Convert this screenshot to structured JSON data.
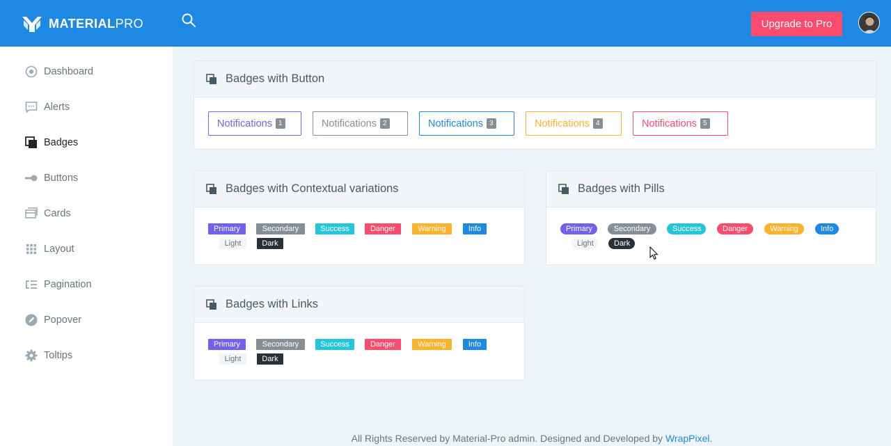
{
  "header": {
    "brand_bold": "MATERIAL",
    "brand_light": "PRO",
    "upgrade_label": "Upgrade to Pro",
    "brand_color": "#1e88e5",
    "upgrade_color": "#fc4b6c"
  },
  "sidebar": {
    "items": [
      {
        "label": "Dashboard",
        "icon": "target-icon"
      },
      {
        "label": "Alerts",
        "icon": "message-icon"
      },
      {
        "label": "Badges",
        "icon": "copy-icon",
        "active": true
      },
      {
        "label": "Buttons",
        "icon": "toggle-icon"
      },
      {
        "label": "Cards",
        "icon": "cards-icon"
      },
      {
        "label": "Layout",
        "icon": "grid-icon"
      },
      {
        "label": "Pagination",
        "icon": "list-icon"
      },
      {
        "label": "Popover",
        "icon": "pen-icon"
      },
      {
        "label": "Toltips",
        "icon": "gear-icon"
      }
    ]
  },
  "cards": {
    "buttons": {
      "title": "Badges with Button",
      "items": [
        {
          "label": "Notifications",
          "count": "1",
          "color": "#7460ee"
        },
        {
          "label": "Notifications",
          "count": "2",
          "color": "#868e96"
        },
        {
          "label": "Notifications",
          "count": "3",
          "color": "#1e88e5"
        },
        {
          "label": "Notifications",
          "count": "4",
          "color": "#ffb22b"
        },
        {
          "label": "Notifications",
          "count": "5",
          "color": "#fc4b6c"
        }
      ]
    },
    "contextual": {
      "title": "Badges with Contextual variations",
      "badges": [
        "Primary",
        "Secondary",
        "Success",
        "Danger",
        "Warning",
        "Info",
        "Light",
        "Dark"
      ]
    },
    "pills": {
      "title": "Badges with Pills",
      "badges": [
        "Primary",
        "Secondary",
        "Success",
        "Danger",
        "Warning",
        "Info",
        "Light",
        "Dark"
      ]
    },
    "links": {
      "title": "Badges with Links",
      "badges": [
        "Primary",
        "Secondary",
        "Success",
        "Danger",
        "Warning",
        "Info",
        "Light",
        "Dark"
      ]
    }
  },
  "badge_colors": {
    "Primary": "#7460ee",
    "Secondary": "#868e96",
    "Success": "#26c6da",
    "Danger": "#fc4b6c",
    "Warning": "#ffb22b",
    "Info": "#1e88e5",
    "Light": "#f2f4f8",
    "Dark": "#263238"
  },
  "footer": {
    "text": "All Rights Reserved by Material-Pro admin. Designed and Developed by ",
    "link": "WrapPixel",
    "end": "."
  }
}
